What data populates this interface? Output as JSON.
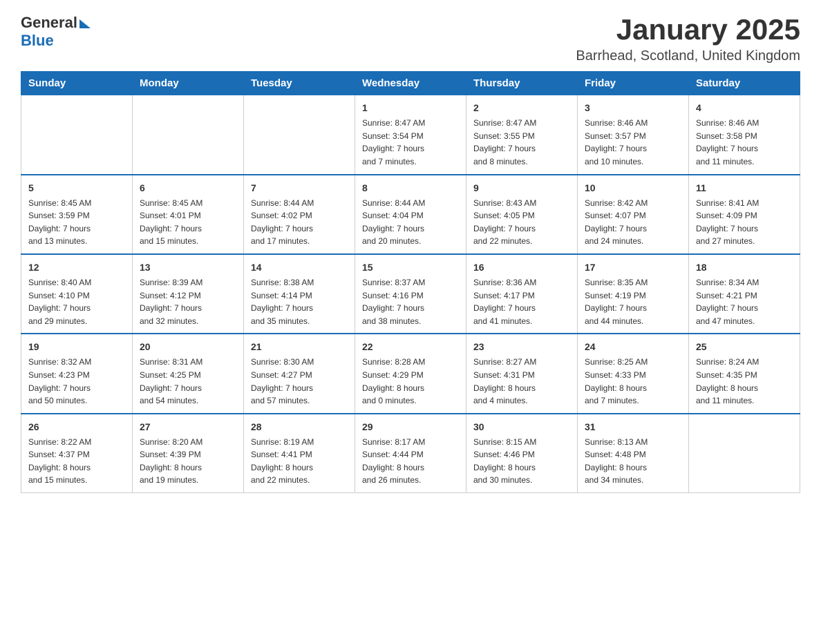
{
  "header": {
    "logo_general": "General",
    "logo_blue": "Blue",
    "title": "January 2025",
    "subtitle": "Barrhead, Scotland, United Kingdom"
  },
  "calendar": {
    "days_of_week": [
      "Sunday",
      "Monday",
      "Tuesday",
      "Wednesday",
      "Thursday",
      "Friday",
      "Saturday"
    ],
    "weeks": [
      [
        {
          "day": "",
          "info": ""
        },
        {
          "day": "",
          "info": ""
        },
        {
          "day": "",
          "info": ""
        },
        {
          "day": "1",
          "info": "Sunrise: 8:47 AM\nSunset: 3:54 PM\nDaylight: 7 hours\nand 7 minutes."
        },
        {
          "day": "2",
          "info": "Sunrise: 8:47 AM\nSunset: 3:55 PM\nDaylight: 7 hours\nand 8 minutes."
        },
        {
          "day": "3",
          "info": "Sunrise: 8:46 AM\nSunset: 3:57 PM\nDaylight: 7 hours\nand 10 minutes."
        },
        {
          "day": "4",
          "info": "Sunrise: 8:46 AM\nSunset: 3:58 PM\nDaylight: 7 hours\nand 11 minutes."
        }
      ],
      [
        {
          "day": "5",
          "info": "Sunrise: 8:45 AM\nSunset: 3:59 PM\nDaylight: 7 hours\nand 13 minutes."
        },
        {
          "day": "6",
          "info": "Sunrise: 8:45 AM\nSunset: 4:01 PM\nDaylight: 7 hours\nand 15 minutes."
        },
        {
          "day": "7",
          "info": "Sunrise: 8:44 AM\nSunset: 4:02 PM\nDaylight: 7 hours\nand 17 minutes."
        },
        {
          "day": "8",
          "info": "Sunrise: 8:44 AM\nSunset: 4:04 PM\nDaylight: 7 hours\nand 20 minutes."
        },
        {
          "day": "9",
          "info": "Sunrise: 8:43 AM\nSunset: 4:05 PM\nDaylight: 7 hours\nand 22 minutes."
        },
        {
          "day": "10",
          "info": "Sunrise: 8:42 AM\nSunset: 4:07 PM\nDaylight: 7 hours\nand 24 minutes."
        },
        {
          "day": "11",
          "info": "Sunrise: 8:41 AM\nSunset: 4:09 PM\nDaylight: 7 hours\nand 27 minutes."
        }
      ],
      [
        {
          "day": "12",
          "info": "Sunrise: 8:40 AM\nSunset: 4:10 PM\nDaylight: 7 hours\nand 29 minutes."
        },
        {
          "day": "13",
          "info": "Sunrise: 8:39 AM\nSunset: 4:12 PM\nDaylight: 7 hours\nand 32 minutes."
        },
        {
          "day": "14",
          "info": "Sunrise: 8:38 AM\nSunset: 4:14 PM\nDaylight: 7 hours\nand 35 minutes."
        },
        {
          "day": "15",
          "info": "Sunrise: 8:37 AM\nSunset: 4:16 PM\nDaylight: 7 hours\nand 38 minutes."
        },
        {
          "day": "16",
          "info": "Sunrise: 8:36 AM\nSunset: 4:17 PM\nDaylight: 7 hours\nand 41 minutes."
        },
        {
          "day": "17",
          "info": "Sunrise: 8:35 AM\nSunset: 4:19 PM\nDaylight: 7 hours\nand 44 minutes."
        },
        {
          "day": "18",
          "info": "Sunrise: 8:34 AM\nSunset: 4:21 PM\nDaylight: 7 hours\nand 47 minutes."
        }
      ],
      [
        {
          "day": "19",
          "info": "Sunrise: 8:32 AM\nSunset: 4:23 PM\nDaylight: 7 hours\nand 50 minutes."
        },
        {
          "day": "20",
          "info": "Sunrise: 8:31 AM\nSunset: 4:25 PM\nDaylight: 7 hours\nand 54 minutes."
        },
        {
          "day": "21",
          "info": "Sunrise: 8:30 AM\nSunset: 4:27 PM\nDaylight: 7 hours\nand 57 minutes."
        },
        {
          "day": "22",
          "info": "Sunrise: 8:28 AM\nSunset: 4:29 PM\nDaylight: 8 hours\nand 0 minutes."
        },
        {
          "day": "23",
          "info": "Sunrise: 8:27 AM\nSunset: 4:31 PM\nDaylight: 8 hours\nand 4 minutes."
        },
        {
          "day": "24",
          "info": "Sunrise: 8:25 AM\nSunset: 4:33 PM\nDaylight: 8 hours\nand 7 minutes."
        },
        {
          "day": "25",
          "info": "Sunrise: 8:24 AM\nSunset: 4:35 PM\nDaylight: 8 hours\nand 11 minutes."
        }
      ],
      [
        {
          "day": "26",
          "info": "Sunrise: 8:22 AM\nSunset: 4:37 PM\nDaylight: 8 hours\nand 15 minutes."
        },
        {
          "day": "27",
          "info": "Sunrise: 8:20 AM\nSunset: 4:39 PM\nDaylight: 8 hours\nand 19 minutes."
        },
        {
          "day": "28",
          "info": "Sunrise: 8:19 AM\nSunset: 4:41 PM\nDaylight: 8 hours\nand 22 minutes."
        },
        {
          "day": "29",
          "info": "Sunrise: 8:17 AM\nSunset: 4:44 PM\nDaylight: 8 hours\nand 26 minutes."
        },
        {
          "day": "30",
          "info": "Sunrise: 8:15 AM\nSunset: 4:46 PM\nDaylight: 8 hours\nand 30 minutes."
        },
        {
          "day": "31",
          "info": "Sunrise: 8:13 AM\nSunset: 4:48 PM\nDaylight: 8 hours\nand 34 minutes."
        },
        {
          "day": "",
          "info": ""
        }
      ]
    ]
  }
}
